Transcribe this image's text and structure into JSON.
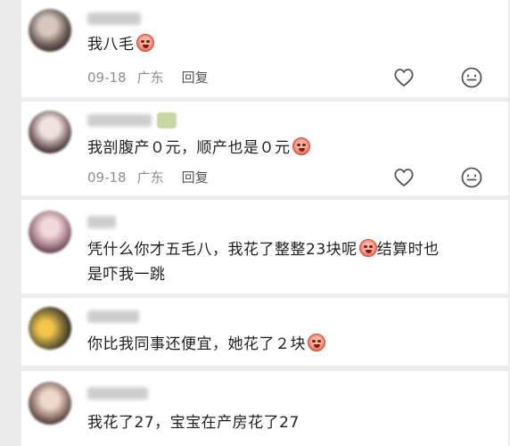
{
  "comments": [
    {
      "text": "我八毛",
      "has_emoji": true,
      "date": "09-18",
      "location": "广东",
      "reply_label": "回复",
      "show_actions": true
    },
    {
      "text": "我剖腹产０元，顺产也是０元",
      "has_emoji": true,
      "date": "09-18",
      "location": "广东",
      "reply_label": "回复",
      "show_actions": true
    },
    {
      "text_line1": "凭什么你才五毛八，我花了整整23块呢",
      "text_line1_after": "结算时也",
      "text_line2": "是吓我一跳",
      "has_emoji": true
    },
    {
      "text": "你比我同事还便宜，她花了２块",
      "has_emoji": true
    },
    {
      "text": "我花了27，宝宝在产房花了27",
      "has_emoji": false
    }
  ],
  "icons": {
    "like": "heart-icon",
    "emoji": "smile-icon"
  },
  "colors": {
    "background": "#ececec",
    "card": "#ffffff",
    "text": "#1f1f1f",
    "meta": "#8f8f8f",
    "emoji_red": "#f06a52"
  }
}
